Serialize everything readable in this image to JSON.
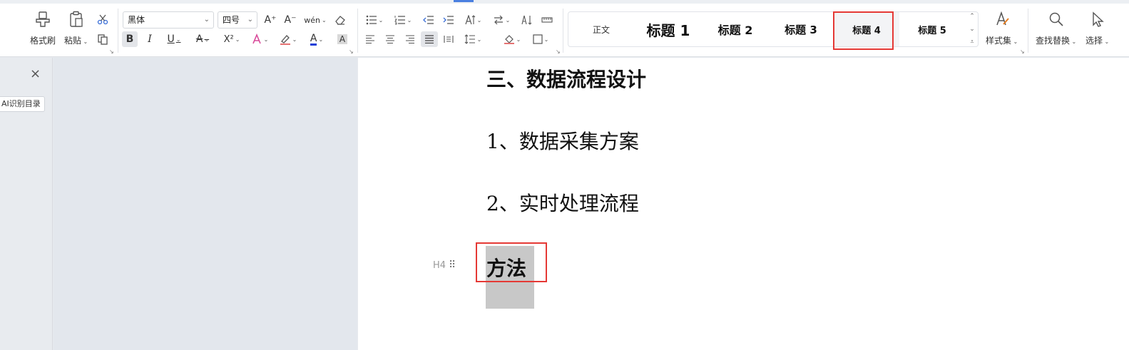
{
  "ribbon": {
    "format_painter_label": "格式刷",
    "paste_label": "粘贴",
    "font_name": "黑体",
    "font_size": "四号",
    "bold": "B",
    "italic": "I",
    "underline": "U",
    "strike": "A",
    "superscript": "X²",
    "font_color_glyph": "A",
    "char_shading_glyph": "A",
    "phonetic_glyph": "wén",
    "grow_font": "A⁺",
    "shrink_font": "A⁻"
  },
  "styles": {
    "items": [
      {
        "label": "正文"
      },
      {
        "label": "标题 1"
      },
      {
        "label": "标题 2"
      },
      {
        "label": "标题 3"
      },
      {
        "label": "标题 4"
      },
      {
        "label": "标题 5"
      }
    ],
    "selected": "标题 4",
    "style_set_label": "样式集",
    "find_replace_label": "查找替换",
    "select_label": "选择"
  },
  "nav_pane": {
    "ai_toc_label": "AI识别目录"
  },
  "document": {
    "heading_main": "三、数据流程设计",
    "item1": "1、数据采集方案",
    "item2": "2、实时处理流程",
    "selected_text": "方法",
    "paragraph_tag": "H4",
    "drag_handle": "⠿"
  },
  "colors": {
    "highlight_border": "#e53935",
    "selection_bg": "#c8c8c8",
    "font_color_underline": "#1a3fd8"
  }
}
